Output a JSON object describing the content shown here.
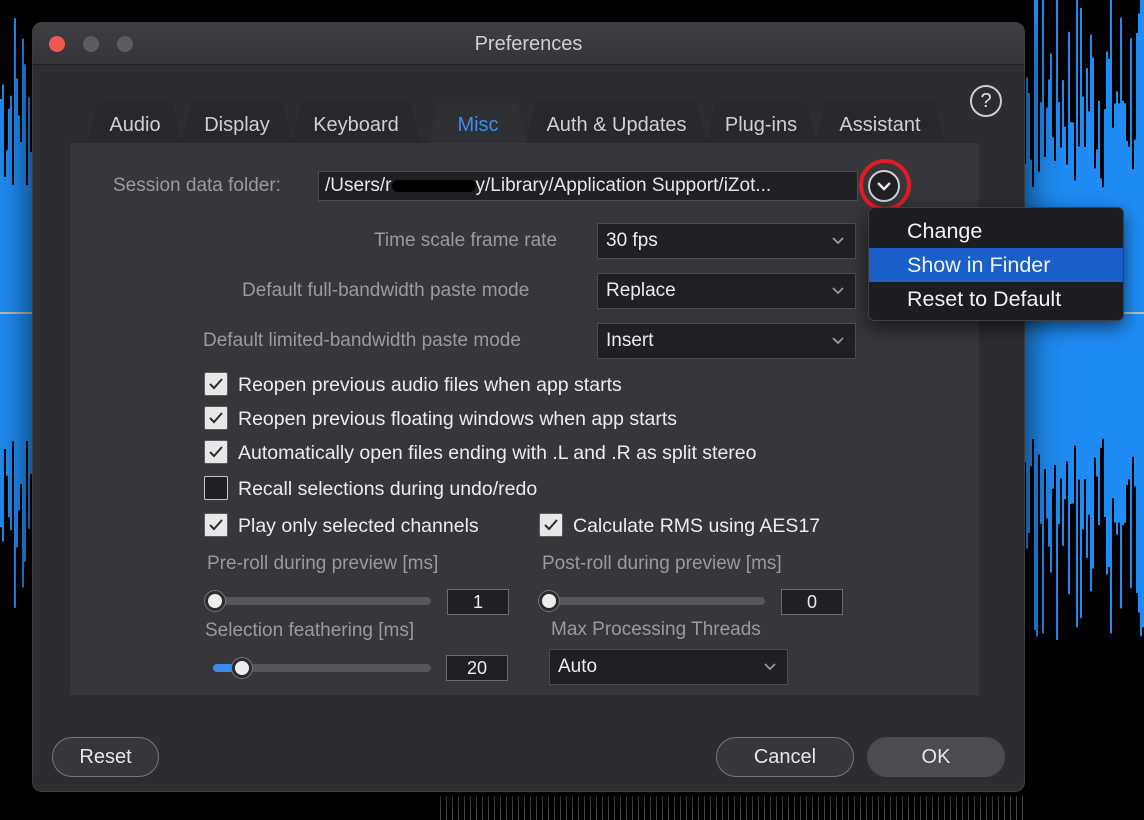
{
  "window": {
    "title": "Preferences",
    "help_label": "?"
  },
  "tabs": [
    {
      "label": "Audio",
      "active": false
    },
    {
      "label": "Display",
      "active": false
    },
    {
      "label": "Keyboard",
      "active": false
    },
    {
      "label": "Misc",
      "active": true
    },
    {
      "label": "Auth & Updates",
      "active": false
    },
    {
      "label": "Plug-ins",
      "active": false
    },
    {
      "label": "Assistant",
      "active": false
    }
  ],
  "session": {
    "label": "Session data folder:",
    "path_prefix": "/Users/r",
    "path_suffix": "y/Library/Application Support/iZot..."
  },
  "fields": {
    "frame_rate": {
      "label": "Time scale frame rate",
      "value": "30 fps"
    },
    "full_paste": {
      "label": "Default full-bandwidth paste mode",
      "value": "Replace"
    },
    "limited_paste": {
      "label": "Default limited-bandwidth paste mode",
      "value": "Insert"
    }
  },
  "checkboxes": [
    {
      "label": "Reopen previous audio files when app starts",
      "checked": true
    },
    {
      "label": "Reopen previous floating windows when app starts",
      "checked": true
    },
    {
      "label": "Automatically open files ending with .L and .R as split stereo",
      "checked": true
    },
    {
      "label": "Recall selections during undo/redo",
      "checked": false
    },
    {
      "label": "Play only selected channels",
      "checked": true
    },
    {
      "label": "Calculate RMS using AES17",
      "checked": true
    }
  ],
  "sliders": {
    "preroll": {
      "label": "Pre-roll during preview [ms]",
      "value": "1"
    },
    "postroll": {
      "label": "Post-roll during preview [ms]",
      "value": "0"
    },
    "feather": {
      "label": "Selection feathering [ms]",
      "value": "20"
    }
  },
  "threads": {
    "label": "Max Processing Threads",
    "value": "Auto"
  },
  "footer": {
    "reset": "Reset",
    "cancel": "Cancel",
    "ok": "OK"
  },
  "menu": {
    "items": [
      {
        "label": "Change",
        "highlighted": false
      },
      {
        "label": "Show in Finder",
        "highlighted": true
      },
      {
        "label": "Reset to Default",
        "highlighted": false
      }
    ]
  },
  "colors": {
    "accent": "#3c8cf0",
    "highlight": "#1a5ec8",
    "annotation": "#e01b24",
    "waveform": "#1f8cf5"
  }
}
